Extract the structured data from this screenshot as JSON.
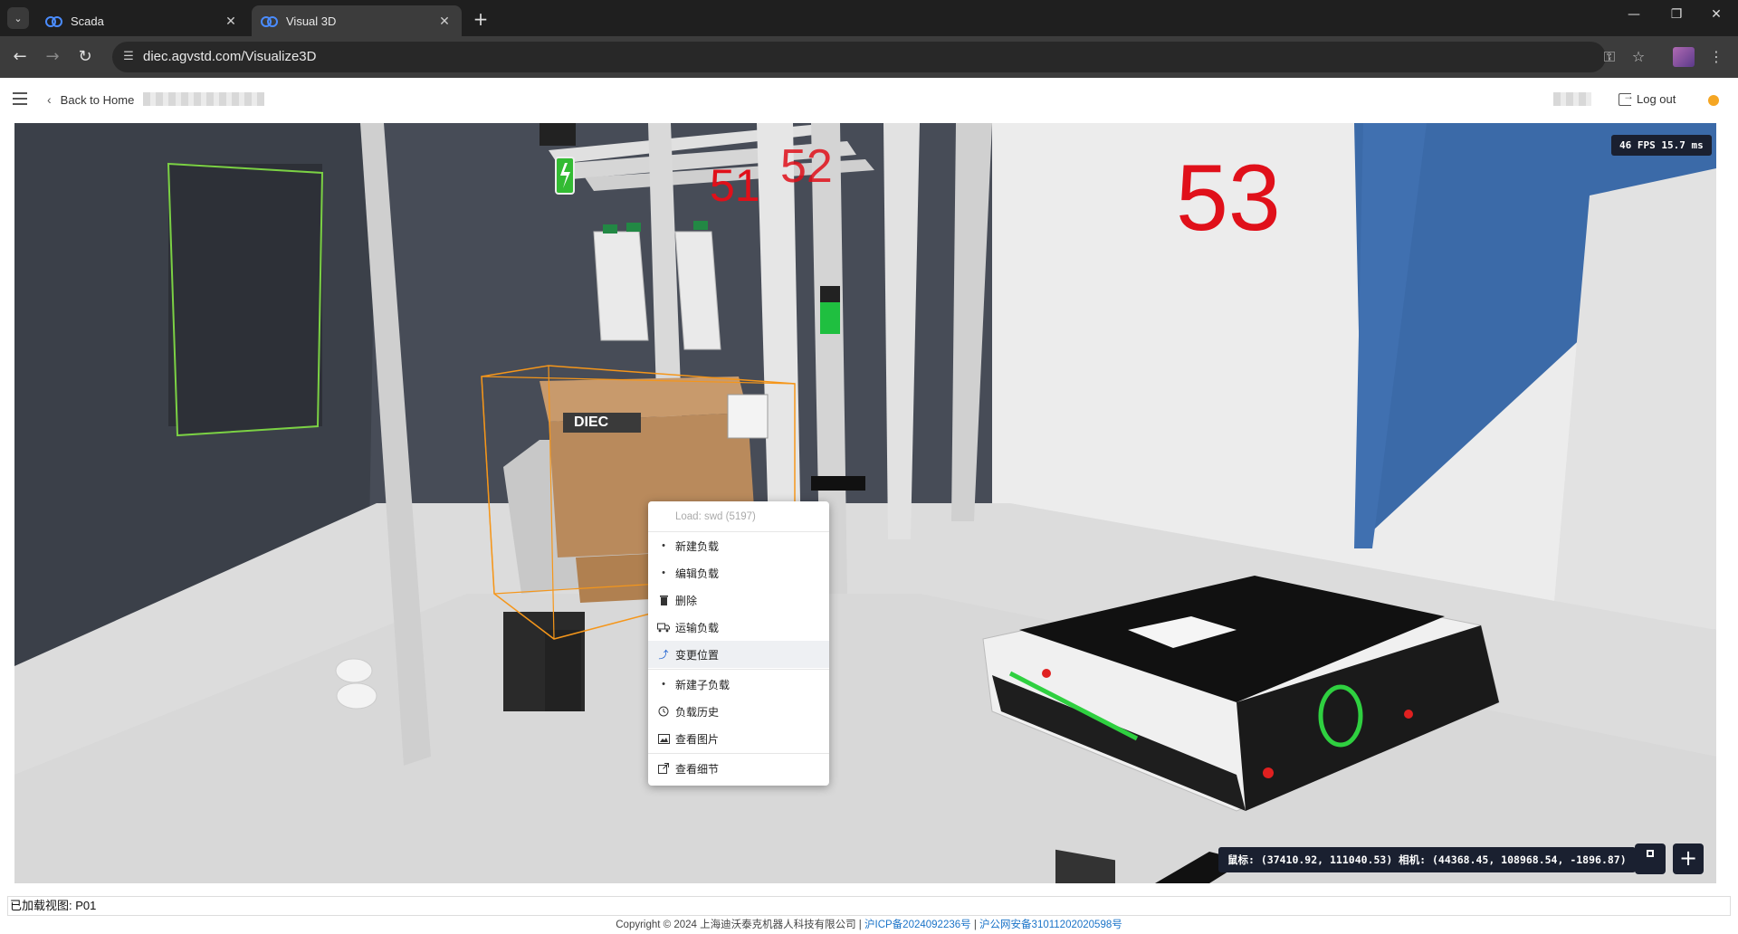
{
  "browser": {
    "tabs": [
      {
        "title": "Scada",
        "active": false
      },
      {
        "title": "Visual 3D",
        "active": true
      }
    ],
    "url": "diec.agvstd.com/Visualize3D",
    "profile_color": "#8e4fa0"
  },
  "header": {
    "back_label": "Back to Home",
    "logout_label": "Log out",
    "status_color": "#f5a623"
  },
  "viewport": {
    "fps_text": "46 FPS  15.7 ms",
    "location_labels": [
      "51",
      "52",
      "53"
    ],
    "load_box_text": "DIEC",
    "coords_text": "鼠标: (37410.92, 111040.53) 相机: (44368.45, 108968.54, -1896.87)"
  },
  "context_menu": {
    "header": "Load: swd (5197)",
    "items": [
      {
        "label": "新建负载",
        "icon": "dot-icon"
      },
      {
        "label": "编辑负载",
        "icon": "dot-icon"
      },
      {
        "label": "删除",
        "icon": "trash-icon"
      },
      {
        "label": "运输负载",
        "icon": "truck-icon"
      },
      {
        "label": "变更位置",
        "icon": "move-icon",
        "hovered": true
      },
      {
        "label": "新建子负载",
        "icon": "dot-icon"
      },
      {
        "label": "负载历史",
        "icon": "clock-icon"
      },
      {
        "label": "查看图片",
        "icon": "image-icon"
      },
      {
        "label": "查看细节",
        "icon": "external-link-icon"
      }
    ]
  },
  "footer": {
    "loaded_view": "已加载视图: P01",
    "copyright": "Copyright © 2024 上海迪沃泰克机器人科技有限公司 |",
    "icp": "沪ICP备2024092236号",
    "separator": "|",
    "police": "沪公网安备31011202020598号"
  }
}
